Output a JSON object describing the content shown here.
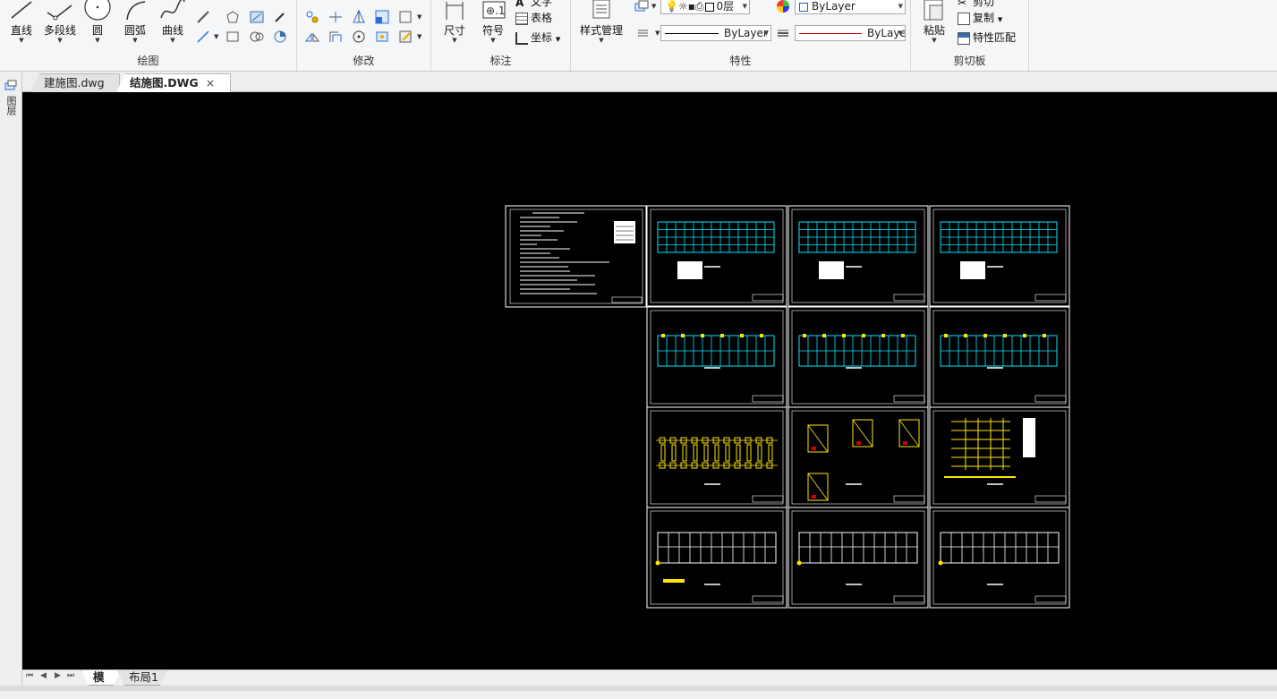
{
  "ribbon": {
    "draw": {
      "label": "绘图",
      "line": "直线",
      "polyline": "多段线",
      "circle": "圆",
      "arc": "圆弧",
      "curve": "曲线"
    },
    "modify": {
      "label": "修改"
    },
    "annotate": {
      "label": "标注",
      "dimension": "尺寸",
      "symbol": "符号",
      "text": "文字",
      "table": "表格",
      "coordinate": "坐标"
    },
    "properties": {
      "label": "特性",
      "style_manager": "样式管理",
      "layer_value": "0层",
      "color_value": "ByLayer",
      "linetype_value": "ByLayer",
      "lineweight_value": "ByLayer"
    },
    "clipboard": {
      "label": "剪切板",
      "paste": "粘贴",
      "cut": "剪切",
      "copy": "复制",
      "match_properties": "特性匹配"
    }
  },
  "tabs": [
    {
      "label": "建施图.dwg"
    },
    {
      "label": "结施图.DWG",
      "close": "×"
    }
  ],
  "left_panel": {
    "label": "图层"
  },
  "layout_tabs": [
    {
      "label": "模型"
    },
    {
      "label": "布局1"
    }
  ],
  "colors": {
    "canvas_bg": "#000000",
    "frame_white": "#ffffff",
    "grid_cyan": "#00e5ff",
    "detail_yellow": "#ffe600",
    "linetype_red": "#c00000",
    "color_box_blue": "#1f5fbf"
  }
}
